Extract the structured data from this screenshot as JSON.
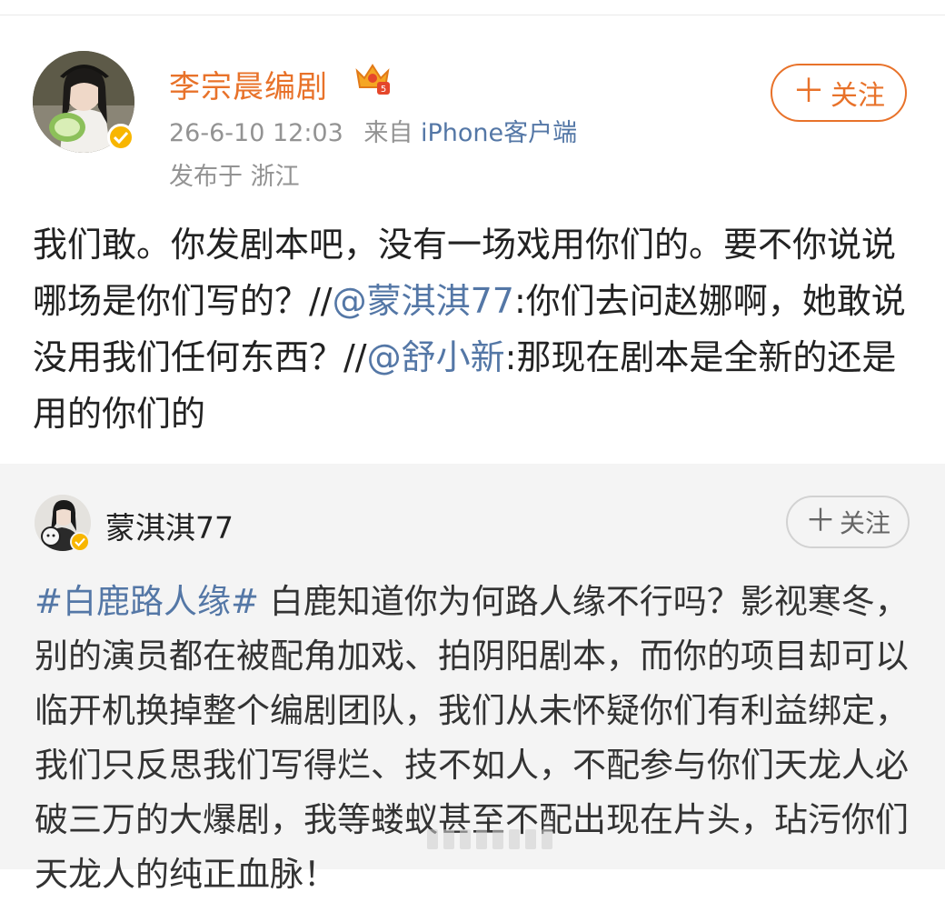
{
  "post": {
    "author": "李宗晨编剧",
    "time": "26-6-10 12:03",
    "from_prefix": "来自",
    "source": "iPhone客户端",
    "location": "发布于 浙江",
    "follow_label": "关注",
    "content": [
      {
        "type": "text",
        "text": "我们敢。你发剧本吧，没有一场戏用你们的。要不你说说哪场是你们写的？//"
      },
      {
        "type": "mention",
        "text": "@蒙淇淇77"
      },
      {
        "type": "text",
        "text": ":你们去问赵娜啊，她敢说没用我们任何东西？//"
      },
      {
        "type": "mention",
        "text": "@舒小新"
      },
      {
        "type": "text",
        "text": ":那现在剧本是全新的还是用的你们的"
      }
    ]
  },
  "retweet": {
    "author": "蒙淇淇77",
    "follow_label": "关注",
    "content": [
      {
        "type": "hashtag",
        "text": "#白鹿路人缘#"
      },
      {
        "type": "text",
        "text": " 白鹿知道你为何路人缘不行吗？影视寒冬，别的演员都在被配角加戏、拍阴阳剧本，而你的项目却可以临开机换掉整个编剧团队，我们从未怀疑你们有利益绑定，我们只反思我们写得烂、技不如人，不配参与你们天龙人必破三万的大爆剧，我等蝼蚁甚至不配出现在片头，玷污你们天龙人的纯正血脉！"
      }
    ]
  },
  "colors": {
    "accent": "#e8722a",
    "link": "#5477a6",
    "verified": "#f8b600"
  }
}
